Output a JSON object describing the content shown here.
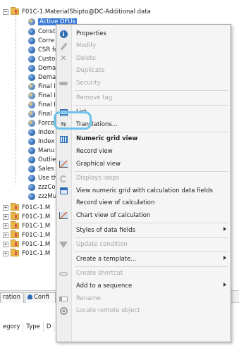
{
  "tree": {
    "root": "F01C-1.MaterialShipto@DC-Additional data",
    "selected": "Active DFUs",
    "children": [
      {
        "label": "Const",
        "icon": "blue-sphere-icon"
      },
      {
        "label": "Corre",
        "icon": "blue-sphere-icon"
      },
      {
        "label": "CSR fc",
        "icon": "blue-sphere-icon"
      },
      {
        "label": "Custo",
        "icon": "blue-sphere-icon"
      },
      {
        "label": "Dema",
        "icon": "blue-sphere-icon"
      },
      {
        "label": "Dema",
        "icon": "blue-sphere-icon"
      },
      {
        "label": "Final I",
        "icon": "multi-sphere-icon"
      },
      {
        "label": "Final I",
        "icon": "multi-sphere-icon"
      },
      {
        "label": "Final I",
        "icon": "multi-sphere-icon"
      },
      {
        "label": "Final",
        "icon": "multi-sphere-icon"
      },
      {
        "label": "Force",
        "icon": "multi-sphere-icon"
      },
      {
        "label": "Index",
        "icon": "blue-sphere-icon"
      },
      {
        "label": "Index",
        "icon": "blue-sphere-icon"
      },
      {
        "label": "Manu",
        "icon": "blue-sphere-icon"
      },
      {
        "label": "Outlie",
        "icon": "blue-sphere-icon"
      },
      {
        "label": "Sales",
        "icon": "blue-sphere-icon"
      },
      {
        "label": "Use th",
        "icon": "blue-sphere-icon"
      },
      {
        "label": "zzzCo",
        "icon": "blue-sphere-icon"
      },
      {
        "label": "zzzMu",
        "icon": "blue-sphere-icon"
      }
    ],
    "siblings": [
      "F01C-1.M",
      "F01C-1.M",
      "F01C-1.M",
      "F01C-1.M",
      "F01C-1.M",
      "F01C-1.M"
    ]
  },
  "context_menu": {
    "items": [
      {
        "label": "Properties",
        "icon": "info-icon",
        "enabled": true,
        "bold": false
      },
      {
        "label": "Modify",
        "icon": "pencil-icon",
        "enabled": false,
        "bold": false
      },
      {
        "label": "Delete",
        "icon": "delete-x-icon",
        "enabled": false,
        "bold": false
      },
      {
        "label": "Duplicate",
        "icon": "",
        "enabled": false,
        "bold": false
      },
      {
        "label": "Security",
        "icon": "key-icon",
        "enabled": false,
        "bold": false
      },
      {
        "label": "Remove tag",
        "icon": "",
        "enabled": false,
        "bold": false
      },
      {
        "label": "List",
        "icon": "list-icon",
        "enabled": true,
        "bold": false
      },
      {
        "label": "Translations...",
        "icon": "translate-icon",
        "enabled": true,
        "bold": false
      },
      {
        "label": "Numeric grid view",
        "icon": "grid-icon",
        "enabled": true,
        "bold": true
      },
      {
        "label": "Record view",
        "icon": "",
        "enabled": true,
        "bold": false
      },
      {
        "label": "Graphical view",
        "icon": "chart-icon",
        "enabled": true,
        "bold": false
      },
      {
        "label": "Displays loops",
        "icon": "loop-icon",
        "enabled": false,
        "bold": false
      },
      {
        "label": "View numeric grid with calculation data fields",
        "icon": "grid-calc-icon",
        "enabled": true,
        "bold": false
      },
      {
        "label": "Record view of calculation",
        "icon": "",
        "enabled": true,
        "bold": false
      },
      {
        "label": "Chart view of calculation",
        "icon": "chart-icon",
        "enabled": true,
        "bold": false
      },
      {
        "label": "Styles of data fields",
        "icon": "",
        "enabled": true,
        "bold": false,
        "submenu": true
      },
      {
        "label": "Update condition",
        "icon": "filter-icon",
        "enabled": false,
        "bold": false
      },
      {
        "label": "Create a template...",
        "icon": "",
        "enabled": true,
        "bold": false,
        "submenu": true
      },
      {
        "label": "Create shortcut",
        "icon": "shortcut-icon",
        "enabled": false,
        "bold": false
      },
      {
        "label": "Add to a sequence",
        "icon": "",
        "enabled": true,
        "bold": false,
        "submenu": true
      },
      {
        "label": "Rename",
        "icon": "rename-icon",
        "enabled": false,
        "bold": false
      },
      {
        "label": "Locate remote object",
        "icon": "locate-icon",
        "enabled": false,
        "bold": false
      }
    ]
  },
  "bottom_tabs": [
    "ration",
    "Confi"
  ],
  "columns": [
    "egory",
    "Type",
    "D"
  ],
  "colors": {
    "selection": "#3d7ad6",
    "highlight_ring": "#6cc3ec",
    "folder": "#e8b94a"
  }
}
